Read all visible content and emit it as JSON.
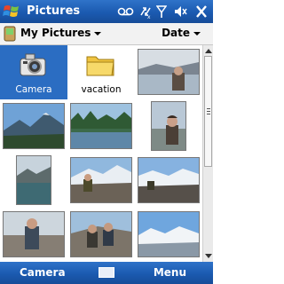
{
  "title_bar": {
    "title": "Pictures",
    "status_icons": [
      "voicemail-icon",
      "connectivity-icon",
      "signal-icon",
      "volume-icon",
      "close-icon"
    ]
  },
  "header": {
    "folder": "My Pictures",
    "sort": "Date"
  },
  "grid": {
    "items": [
      {
        "type": "camera",
        "label": "Camera",
        "selected": true
      },
      {
        "type": "folder",
        "label": "vacation"
      },
      {
        "type": "photo",
        "scene": "lake-person"
      },
      {
        "type": "photo",
        "scene": "mountain-lake"
      },
      {
        "type": "photo",
        "scene": "lake-trees"
      },
      {
        "type": "photo",
        "scene": "person-portrait"
      },
      {
        "type": "photo",
        "scene": "lake-dusk"
      },
      {
        "type": "photo",
        "scene": "person-snow"
      },
      {
        "type": "photo",
        "scene": "snow-rocks"
      },
      {
        "type": "photo",
        "scene": "person-rock"
      },
      {
        "type": "photo",
        "scene": "two-people"
      },
      {
        "type": "photo",
        "scene": "snowy-ridge"
      }
    ]
  },
  "softkeys": {
    "left": "Camera",
    "right": "Menu"
  }
}
